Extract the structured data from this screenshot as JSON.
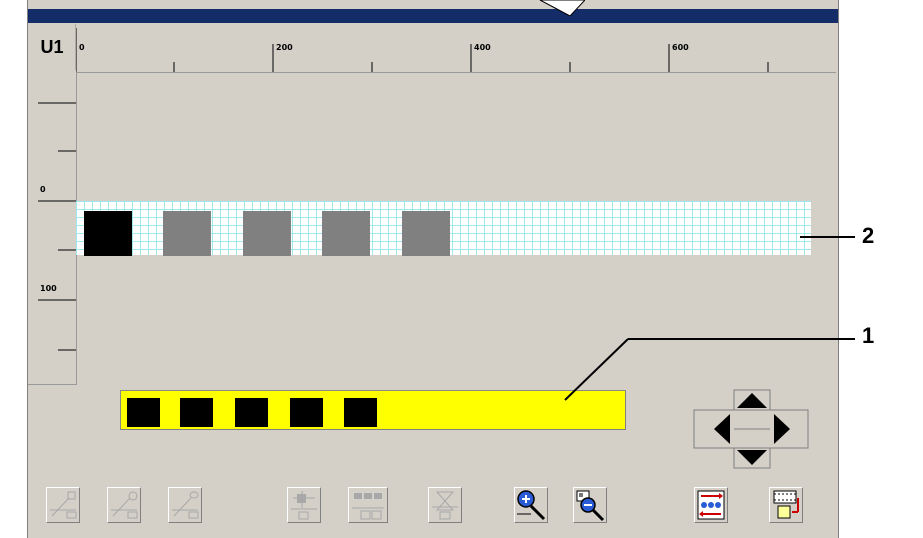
{
  "unit_label": "U1",
  "horizontal_ruler": {
    "labels": [
      "0",
      "200",
      "400",
      "600"
    ]
  },
  "vertical_ruler": {
    "labels": [
      "0",
      "100"
    ]
  },
  "grid_blocks": [
    {
      "color": "#000000"
    },
    {
      "color": "#808080"
    },
    {
      "color": "#808080"
    },
    {
      "color": "#808080"
    },
    {
      "color": "#808080"
    }
  ],
  "yellow_bar": {
    "color": "#ffff00",
    "block_count": 5
  },
  "callouts": {
    "label_1": "1",
    "label_2": "2"
  },
  "toolbar": {
    "buttons": [
      {
        "icon": "line-edit-icon",
        "enabled": false
      },
      {
        "icon": "line-circle-edit-icon",
        "enabled": false
      },
      {
        "icon": "line-dot-edit-icon",
        "enabled": false
      },
      {
        "icon": "layout-align-icon",
        "enabled": false
      },
      {
        "icon": "multi-block-icon",
        "enabled": false
      },
      {
        "icon": "hourglass-icon",
        "enabled": false
      },
      {
        "icon": "zoom-in-icon",
        "enabled": true
      },
      {
        "icon": "zoom-out-icon",
        "enabled": true
      },
      {
        "icon": "sequence-icon",
        "enabled": true
      },
      {
        "icon": "export-frame-icon",
        "enabled": true
      }
    ]
  }
}
